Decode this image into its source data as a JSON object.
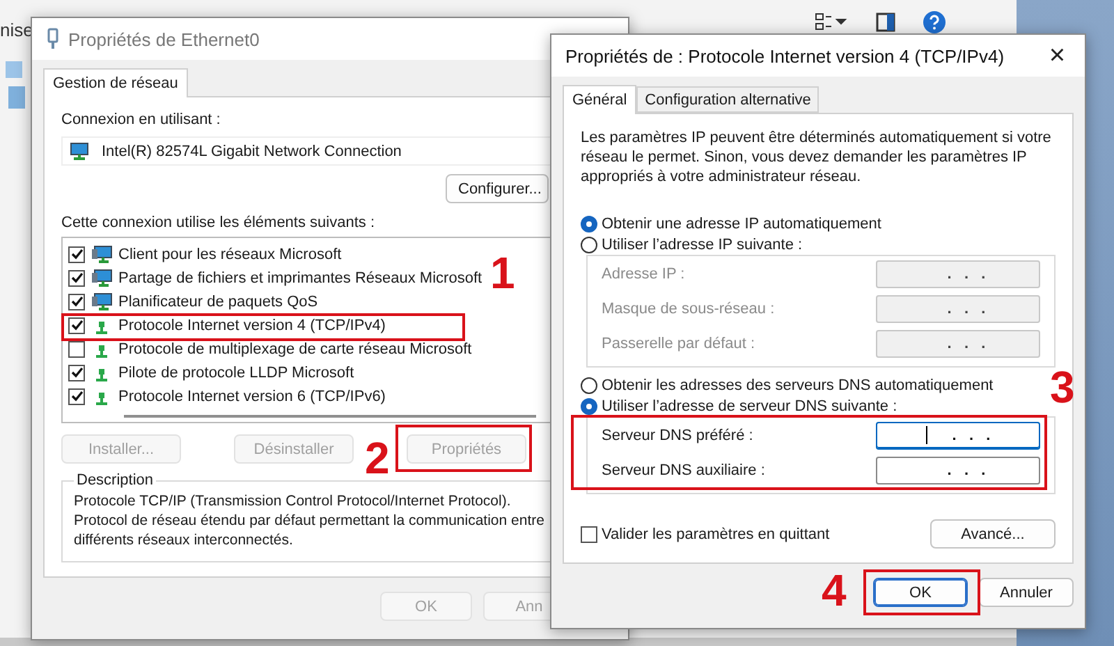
{
  "back_window": {
    "title": "nise"
  },
  "ethernet_window": {
    "title": "Propriétés de Ethernet0",
    "tabs": [
      {
        "label": "Gestion de réseau",
        "selected": true
      }
    ],
    "connection_label": "Connexion en utilisant :",
    "adapter": "Intel(R) 82574L Gigabit Network Connection",
    "configure_button": "Configurer...",
    "items_label": "Cette connexion utilise les éléments suivants :",
    "items": [
      {
        "label": "Client pour les réseaux Microsoft",
        "checked": true,
        "kind": "service"
      },
      {
        "label": "Partage de fichiers et imprimantes Réseaux Microsoft",
        "checked": true,
        "kind": "service"
      },
      {
        "label": "Planificateur de paquets QoS",
        "checked": true,
        "kind": "service"
      },
      {
        "label": "Protocole Internet version 4 (TCP/IPv4)",
        "checked": true,
        "kind": "protocol"
      },
      {
        "label": "Protocole de multiplexage de carte réseau Microsoft",
        "checked": false,
        "kind": "protocol"
      },
      {
        "label": "Pilote de protocole LLDP Microsoft",
        "checked": true,
        "kind": "protocol"
      },
      {
        "label": "Protocole Internet version 6 (TCP/IPv6)",
        "checked": true,
        "kind": "protocol"
      }
    ],
    "buttons": [
      {
        "label": "Installer...",
        "disabled": true
      },
      {
        "label": "Désinstaller",
        "disabled": true
      },
      {
        "label": "Propriétés",
        "disabled": true
      }
    ],
    "description_title": "Description",
    "description": "Protocole TCP/IP (Transmission Control Protocol/Internet Protocol). Protocol de réseau étendu par défaut permettant la communication entre différents réseaux interconnectés.",
    "footer_buttons": [
      {
        "label": "OK",
        "disabled": true
      },
      {
        "label": "Ann",
        "disabled": true
      }
    ]
  },
  "ipv4_dialog": {
    "title": "Propriétés de : Protocole Internet version 4 (TCP/IPv4)",
    "close": "×",
    "tabs": [
      {
        "label": "Général",
        "selected": true
      },
      {
        "label": "Configuration alternative",
        "selected": false
      }
    ],
    "intro": "Les paramètres IP peuvent être déterminés automatiquement si votre réseau le permet. Sinon, vous devez demander les paramètres IP appropriés à votre administrateur réseau.",
    "ip_radios": [
      {
        "label": "Obtenir une adresse IP automatiquement",
        "selected": true
      },
      {
        "label": "Utiliser l’adresse IP suivante :",
        "selected": false
      }
    ],
    "ip_fields": [
      {
        "label": "Adresse IP :",
        "value": ".   .   .",
        "disabled": true,
        "focused": false
      },
      {
        "label": "Masque de sous-réseau :",
        "value": ".   .   .",
        "disabled": true,
        "focused": false
      },
      {
        "label": "Passerelle par défaut :",
        "value": ".   .   .",
        "disabled": true,
        "focused": false
      }
    ],
    "dns_radios": [
      {
        "label": "Obtenir les adresses des serveurs DNS automatiquement",
        "selected": false
      },
      {
        "label": "Utiliser l’adresse de serveur DNS suivante :",
        "selected": true
      }
    ],
    "dns_fields": [
      {
        "label": "Serveur DNS préféré :",
        "value": ".   .   .",
        "disabled": false,
        "focused": true
      },
      {
        "label": "Serveur DNS auxiliaire :",
        "value": ".   .   .",
        "disabled": false,
        "focused": false
      }
    ],
    "validate": {
      "label": "Valider les paramètres en quittant",
      "checked": false
    },
    "advanced_button": "Avancé...",
    "footer_buttons": [
      {
        "label": "OK",
        "default": true
      },
      {
        "label": "Annuler",
        "default": false
      }
    ]
  },
  "annotations": [
    {
      "label": "1"
    },
    {
      "label": "2"
    },
    {
      "label": "3"
    },
    {
      "label": "4"
    }
  ]
}
